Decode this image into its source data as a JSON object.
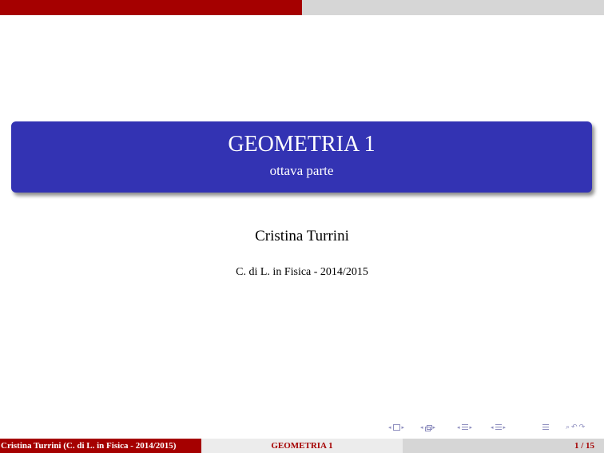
{
  "slide": {
    "title": "GEOMETRIA 1",
    "subtitle": "ottava parte",
    "author": "Cristina Turrini",
    "institute": "C. di L. in Fisica - 2014/2015"
  },
  "footer": {
    "author": "Cristina Turrini",
    "institute": "(C. di L. in Fisica - 2014/2015)",
    "title": "GEOMETRIA 1",
    "page": "1 / 15"
  },
  "colors": {
    "accent_red": "#a50000",
    "title_blue": "#3333b3",
    "nav_gray_blue": "#8e8ebf"
  },
  "nav": {
    "icons": [
      "prev-frame-icon",
      "frame-icon",
      "next-frame-icon",
      "prev-subsection-icon",
      "subsection-icon",
      "next-subsection-icon",
      "prev-section-icon",
      "section-icon",
      "next-section-icon",
      "align-icon",
      "search-icon",
      "undo-icon"
    ]
  }
}
